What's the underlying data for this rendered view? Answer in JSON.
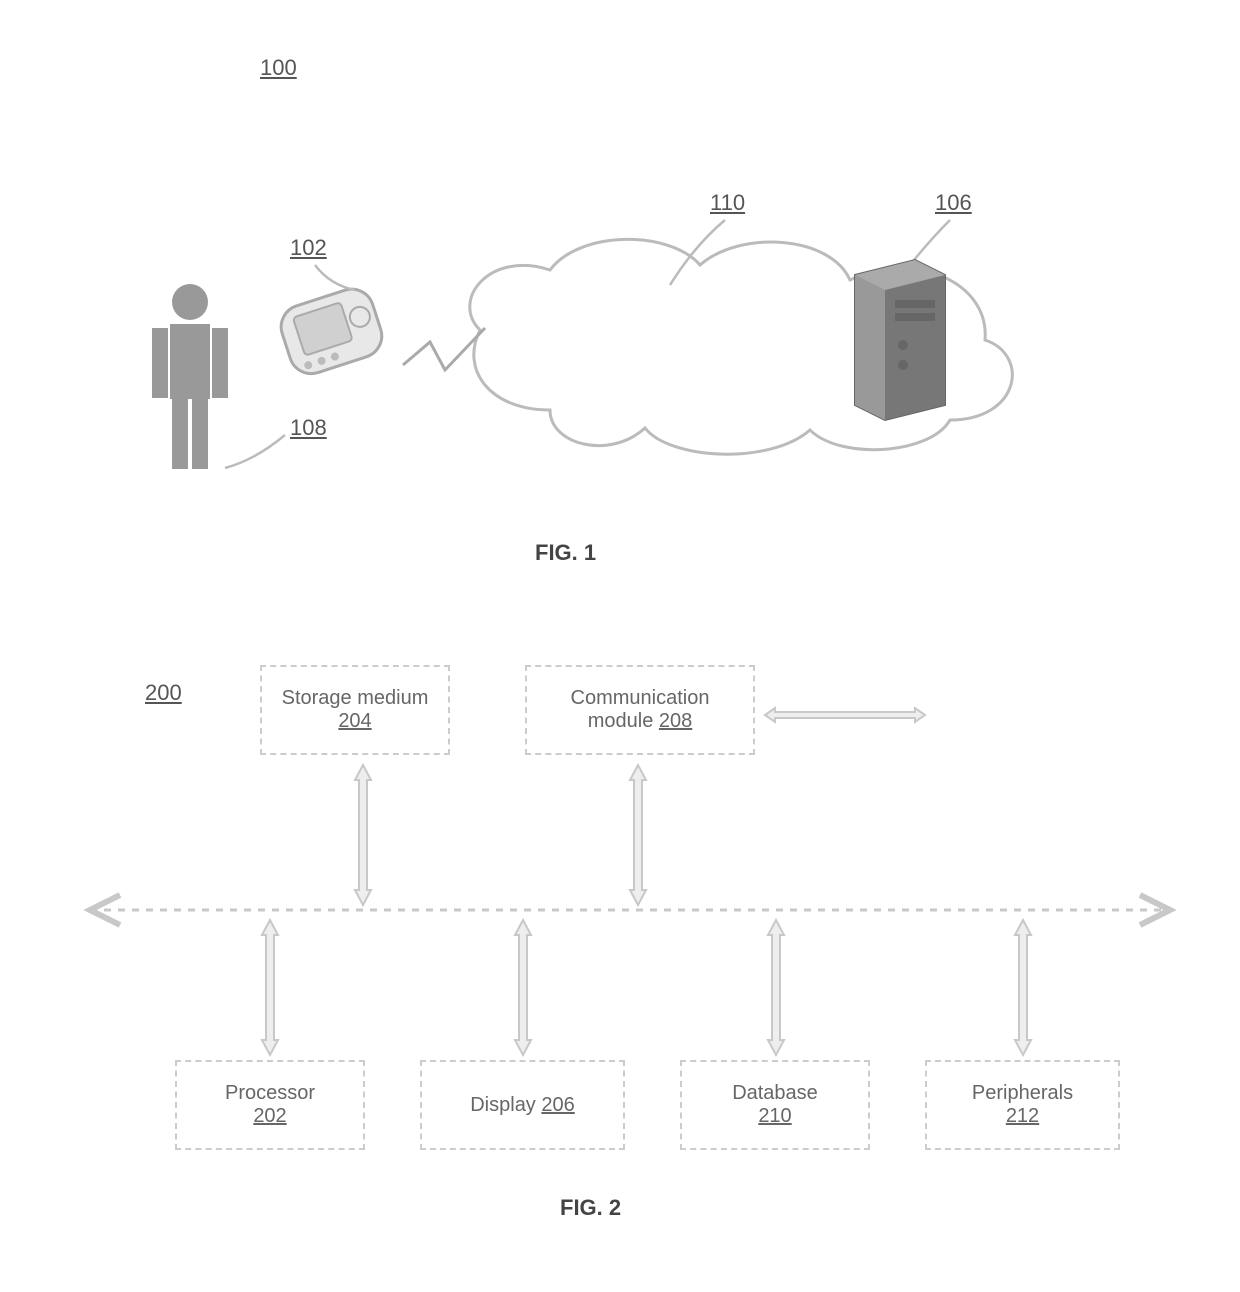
{
  "fig1": {
    "system_ref": "100",
    "device_ref": "102",
    "server_ref": "106",
    "user_ref": "108",
    "cloud_ref": "110",
    "label": "FIG. 1"
  },
  "fig2": {
    "system_ref": "200",
    "storage": {
      "text": "Storage medium ",
      "ref": "204"
    },
    "comm": {
      "text": "Communication module ",
      "ref": "208"
    },
    "processor": {
      "text": "Processor",
      "ref": "202"
    },
    "display": {
      "text": "Display ",
      "ref": "206"
    },
    "database": {
      "text": "Database",
      "ref": "210"
    },
    "peripherals": {
      "text": "Peripherals",
      "ref": "212"
    },
    "label": "FIG. 2"
  }
}
